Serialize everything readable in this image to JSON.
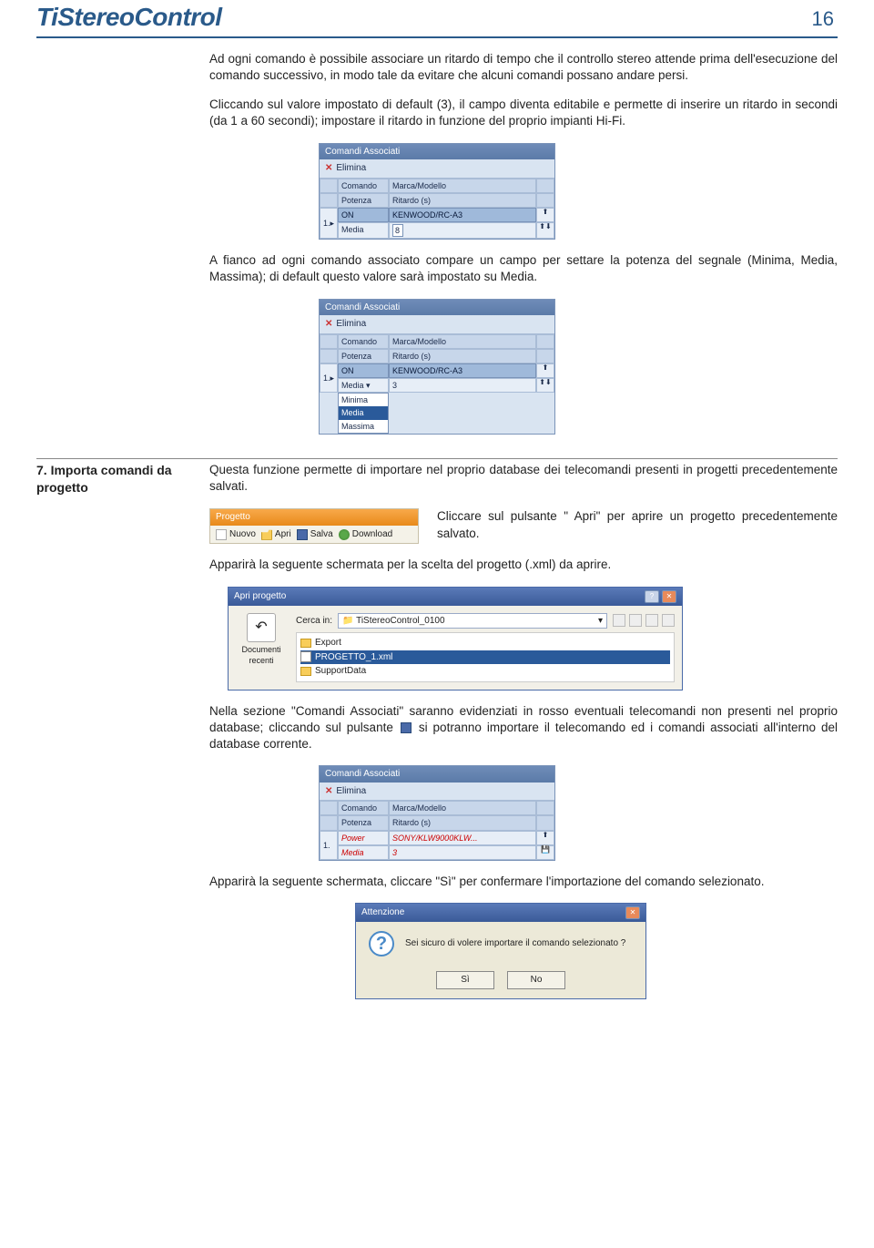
{
  "header": {
    "title": "TiStereoControl",
    "page": "16"
  },
  "p1": "Ad ogni comando è possibile associare un ritardo di tempo che il controllo stereo attende prima dell'esecuzione del comando successivo, in modo tale da evitare che alcuni comandi possano andare persi.",
  "p2": "Cliccando sul valore impostato di default (3), il campo diventa editabile e permette di inserire un ritardo in secondi (da 1 a 60 secondi); impostare il ritardo in funzione del proprio impianti Hi-Fi.",
  "p3": "A fianco ad ogni comando associato compare un campo per settare la potenza del segnale (Minima, Media, Massima); di default questo valore sarà impostato su Media.",
  "section7": {
    "num_title": "7.  Importa comandi da progetto",
    "body": "Questa funzione permette di importare nel proprio database dei telecomandi presenti in progetti precedentemente salvati."
  },
  "progetto": {
    "title": "Progetto",
    "nuovo": "Nuovo",
    "apri": "Apri",
    "salva": "Salva",
    "download": "Download"
  },
  "p4": "Cliccare sul pulsante \" Apri\" per aprire un progetto precedentemente salvato.",
  "p5": "Apparirà la seguente schermata per la scelta del progetto (.xml) da aprire.",
  "openDlg": {
    "title": "Apri progetto",
    "cercaLabel": "Cerca in:",
    "cercaValue": "TiStereoControl_0100",
    "recenti": "Documenti recenti",
    "files": {
      "export": "Export",
      "progetto": "PROGETTO_1.xml",
      "support": "SupportData"
    }
  },
  "p6a": "Nella sezione \"Comandi Associati\" saranno evidenziati in rosso eventuali telecomandi non presenti nel proprio database; cliccando sul pulsante ",
  "p6b": " si potranno importare il telecomando ed i comandi associati all'interno del database corrente.",
  "p7": "Apparirà la seguente schermata, cliccare \"Sì\" per confermare l'importazione del comando selezionato.",
  "attDlg": {
    "title": "Attenzione",
    "msg": "Sei sicuro di volere importare il comando selezionato ?",
    "si": "Sì",
    "no": "No"
  },
  "panel": {
    "title": "Comandi Associati",
    "elimina": "Elimina",
    "h1": "Comando",
    "h2": "Marca/Modello",
    "h3": "Potenza",
    "h4": "Ritardo (s)",
    "rowIdx": "1.",
    "cmdOn": "ON",
    "brandKen": "KENWOOD/RC-A3",
    "potMedia": "Media",
    "ritardo3": "3",
    "inputVal": "8",
    "optMin": "Minima",
    "optMed": "Media",
    "optMax": "Massima",
    "cmdPower": "Power",
    "brandSony": "SONY/KLW9000KLW..."
  }
}
